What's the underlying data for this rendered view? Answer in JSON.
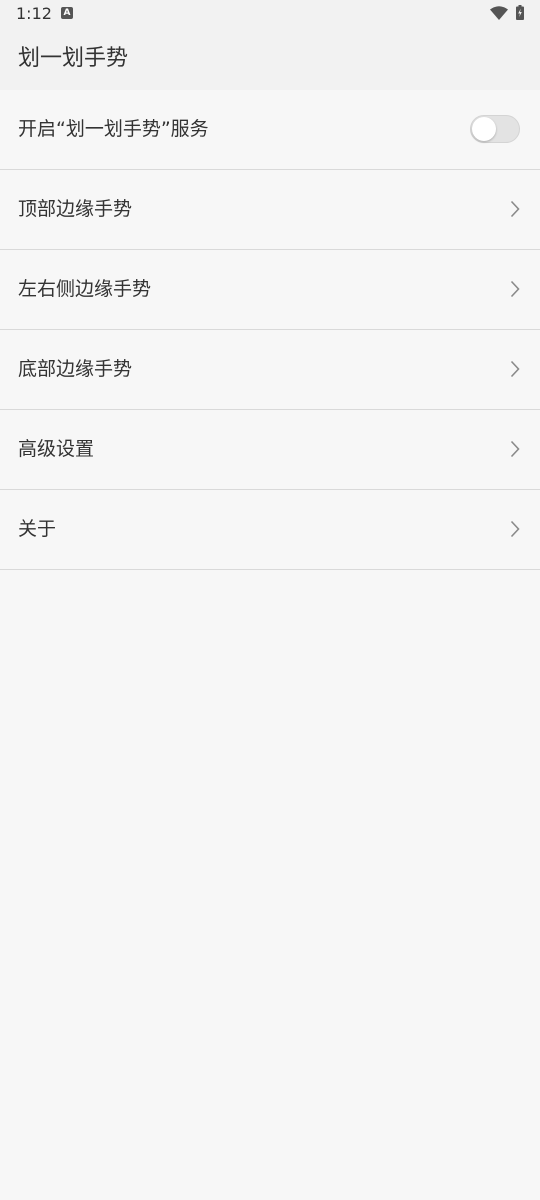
{
  "status_bar": {
    "time": "1:12",
    "notification_icon": "a-notification-icon",
    "wifi_icon": "wifi-icon",
    "battery_icon": "battery-charging-icon"
  },
  "appbar": {
    "title": "划一划手势"
  },
  "settings": {
    "service_toggle": {
      "label": "开启“划一划手势”服务",
      "enabled": false
    },
    "items": [
      {
        "label": "顶部边缘手势",
        "icon": "chevron-right-icon"
      },
      {
        "label": "左右侧边缘手势",
        "icon": "chevron-right-icon"
      },
      {
        "label": "底部边缘手势",
        "icon": "chevron-right-icon"
      },
      {
        "label": "高级设置",
        "icon": "chevron-right-icon"
      },
      {
        "label": "关于",
        "icon": "chevron-right-icon"
      }
    ]
  },
  "colors": {
    "background": "#f7f7f7",
    "appbar": "#f2f2f2",
    "divider": "#d9d9d9",
    "text": "#333333",
    "chevron": "#8a8a8a",
    "toggle_track_off": "#e3e3e3"
  }
}
